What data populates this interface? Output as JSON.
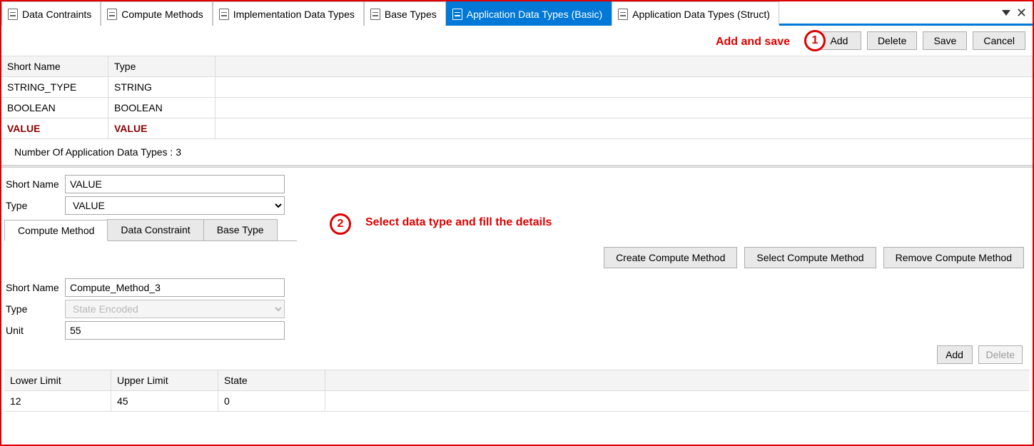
{
  "tabs": [
    {
      "label": "Data Contraints"
    },
    {
      "label": "Compute Methods"
    },
    {
      "label": "Implementation Data Types"
    },
    {
      "label": "Base Types"
    },
    {
      "label": "Application Data Types (Basic)"
    },
    {
      "label": "Application Data Types (Struct)"
    }
  ],
  "toolbar": {
    "add": "Add",
    "delete": "Delete",
    "save": "Save",
    "cancel": "Cancel"
  },
  "annotations": {
    "top_text": "Add and save",
    "top_num": "1",
    "mid_num": "2",
    "mid_text": "Select data type and fill the details"
  },
  "grid": {
    "headers": {
      "short_name": "Short Name",
      "type": "Type"
    },
    "rows": [
      {
        "short_name": "STRING_TYPE",
        "type": "STRING"
      },
      {
        "short_name": "BOOLEAN",
        "type": "BOOLEAN"
      },
      {
        "short_name": "VALUE",
        "type": "VALUE"
      }
    ],
    "count_label": "Number Of Application Data Types : 3"
  },
  "form": {
    "short_name_label": "Short Name",
    "short_name_value": "VALUE",
    "type_label": "Type",
    "type_value": "VALUE",
    "subtabs": {
      "compute_method": "Compute Method",
      "data_constraint": "Data Constraint",
      "base_type": "Base Type"
    }
  },
  "compute_buttons": {
    "create": "Create Compute Method",
    "select": "Select Compute Method",
    "remove": "Remove Compute Method"
  },
  "compute_form": {
    "short_name_label": "Short Name",
    "short_name_value": "Compute_Method_3",
    "type_label": "Type",
    "type_value": "State Encoded",
    "unit_label": "Unit",
    "unit_value": "55"
  },
  "limits_toolbar": {
    "add": "Add",
    "delete": "Delete"
  },
  "limits_grid": {
    "headers": {
      "lower": "Lower Limit",
      "upper": "Upper Limit",
      "state": "State"
    },
    "rows": [
      {
        "lower": "12",
        "upper": "45",
        "state": "0"
      }
    ]
  }
}
